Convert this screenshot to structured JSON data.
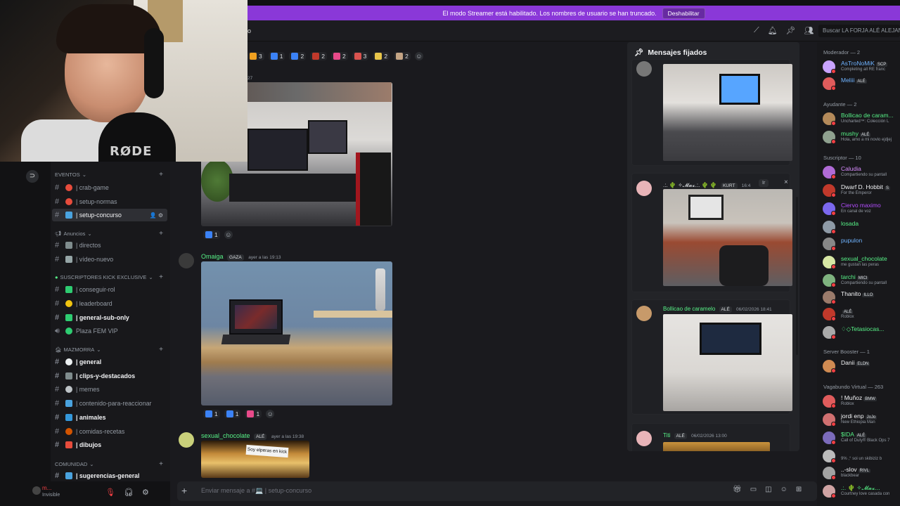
{
  "banner": {
    "text": "El modo Streamer está habilitado. Los nombres de usuario se han truncado.",
    "button": "Deshabilitar"
  },
  "header": {
    "fragment": "o",
    "search_placeholder": "Buscar LA FORJA ALÉ ALEJAN",
    "icons": [
      "threads-icon",
      "bell-icon",
      "pin-icon",
      "members-icon"
    ]
  },
  "server_strip": {
    "glyph": "⊃"
  },
  "channels": {
    "categories": [
      {
        "name": "EVENTOS"
      },
      {
        "name": "Anuncios"
      },
      {
        "name": "SUSCRIPTORES KICK EXCLUSIVE"
      },
      {
        "name": "MAZMORRA"
      },
      {
        "name": "COMUNIDAD"
      }
    ],
    "items": [
      {
        "label": "| crab-game"
      },
      {
        "label": "| setup-normas"
      },
      {
        "label": "| setup-concurso"
      },
      {
        "label": "| directos"
      },
      {
        "label": "| vídeo-nuevo"
      },
      {
        "label": "| conseguir-rol"
      },
      {
        "label": "| leaderboard"
      },
      {
        "label": "| general-sub-only"
      },
      {
        "label": "Plaza FEM VIP"
      },
      {
        "label": "| general"
      },
      {
        "label": "| clips-y-destacados"
      },
      {
        "label": "| memes"
      },
      {
        "label": "| contenido-para-reaccionar"
      },
      {
        "label": "| animales"
      },
      {
        "label": "| comidas-recetas"
      },
      {
        "label": "| dibujos"
      },
      {
        "label": "| sugerencias-general"
      }
    ]
  },
  "user_panel": {
    "name": "m...",
    "status": "Invisible"
  },
  "messages": {
    "top_reactions": [
      {
        "count": "3",
        "color": "#f0a020"
      },
      {
        "count": "1",
        "color": "#3b82f6"
      },
      {
        "count": "2",
        "color": "#3b82f6"
      },
      {
        "count": "2",
        "color": "#c0392b"
      },
      {
        "count": "2",
        "color": "#e84a8a"
      },
      {
        "count": "3",
        "color": "#d9534f"
      },
      {
        "count": "2",
        "color": "#e8c54a"
      },
      {
        "count": "2",
        "color": "#c4a484"
      }
    ],
    "time_fragment": "27",
    "first_reactions": [
      {
        "count": "1",
        "color": "#3b82f6"
      }
    ],
    "omaiga": {
      "name": "Omaiga",
      "badge": "GAZA",
      "time": "ayer a las 19:13"
    },
    "second_reactions": [
      {
        "count": "1",
        "color": "#3b82f6"
      },
      {
        "count": "1",
        "color": "#3b82f6"
      },
      {
        "count": "1",
        "color": "#e84a8a"
      }
    ],
    "sexual": {
      "name": "sexual_chocolate",
      "badge": "ALÉ",
      "time": "ayer a las 19:38"
    },
    "hallway_sign": "Soy elperas en kick"
  },
  "composer": {
    "placeholder": "Enviar mensaje a #💻 | setup-concurso"
  },
  "pinned": {
    "title": "Mensajes fijados",
    "close": "×",
    "go": "Ir",
    "cards": [
      {
        "name": ".:. 🌵 ✧𝓜𝓪𝔁.:. 🌵 🌵",
        "badge": "KURT",
        "time": "16:4"
      },
      {
        "name": "Bollicao de caramelo",
        "badge": "ALÉ",
        "time": "06/02/2026 18:41"
      },
      {
        "name": "Titi",
        "badge": "ALÉ",
        "time": "06/02/2026 13:00"
      }
    ]
  },
  "members": {
    "groups": [
      {
        "label": "Moderador — 2"
      },
      {
        "label": "Ayudante — 2"
      },
      {
        "label": "Suscriptor — 10"
      },
      {
        "label": "Server Booster — 1"
      },
      {
        "label": "Vagabundo Virtual — 263"
      }
    ],
    "list": [
      {
        "name": "AsTroNoMiK",
        "tag": "SCP",
        "status": "Completing all RE franc",
        "color": "#6fb3ff"
      },
      {
        "name": "Meliii",
        "tag": "ALÉ",
        "status": "",
        "color": "#6fb3ff"
      },
      {
        "name": "Bollicao de caram...",
        "tag": "",
        "status": "Uncharted™: Colección L",
        "color": "#57f287"
      },
      {
        "name": "mushy",
        "tag": "ALÉ",
        "status": "Hola, amo a mi novio ejdjej",
        "color": "#57f287"
      },
      {
        "name": "Caludia",
        "tag": "",
        "status": "Compartiendo su pantall",
        "color": "#d98cff"
      },
      {
        "name": "Dwarf D. Hobbit",
        "tag": "S",
        "status": "For the Emperor",
        "color": "#f2f3f5"
      },
      {
        "name": "Ciervo maximo",
        "tag": "",
        "status": "En canal de voz",
        "color": "#b44dff"
      },
      {
        "name": "losada",
        "tag": "",
        "status": "",
        "color": "#57f287"
      },
      {
        "name": "pupulon",
        "tag": "",
        "status": "",
        "color": "#6fb3ff"
      },
      {
        "name": "sexual_chocolate",
        "tag": "",
        "status": "me gustan las peras",
        "color": "#57f287"
      },
      {
        "name": "tarchi",
        "tag": "MICI",
        "status": "Compartiendo su pantall",
        "color": "#57f287"
      },
      {
        "name": "Thanito",
        "tag": "ILLO",
        "status": "",
        "color": "#f2f3f5"
      },
      {
        "name": "",
        "tag": "ALÉ",
        "status": "Roblox",
        "color": "#f2f3f5"
      },
      {
        "name": "♢◇Tetasiocas...",
        "tag": "",
        "status": "",
        "color": "#57f287"
      },
      {
        "name": "Danii",
        "tag": "ELDN",
        "status": "",
        "color": "#f2f3f5"
      },
      {
        "name": "! Muñoz",
        "tag": "BMW",
        "status": "Roblox",
        "color": "#f2f3f5"
      },
      {
        "name": "jordi enp",
        "tag": "JoJo",
        "status": "New Ethiopia Man",
        "color": "#f2f3f5"
      },
      {
        "name": "$IDA",
        "tag": "ALÉ",
        "status": "Call of Duty® Black Ops 7",
        "color": "#57f287"
      },
      {
        "name": "",
        "tag": "",
        "status": "9% ,° soi un skibiziz b",
        "color": "#f2f3f5"
      },
      {
        "name": "..-slov",
        "tag": "RIVL",
        "status": "blackbear",
        "color": "#f2f3f5"
      },
      {
        "name": ".:. 🌵 ✧𝓜𝓪𝔁...",
        "tag": "",
        "status": "Courtney love casada con",
        "color": "#57f287"
      }
    ]
  }
}
